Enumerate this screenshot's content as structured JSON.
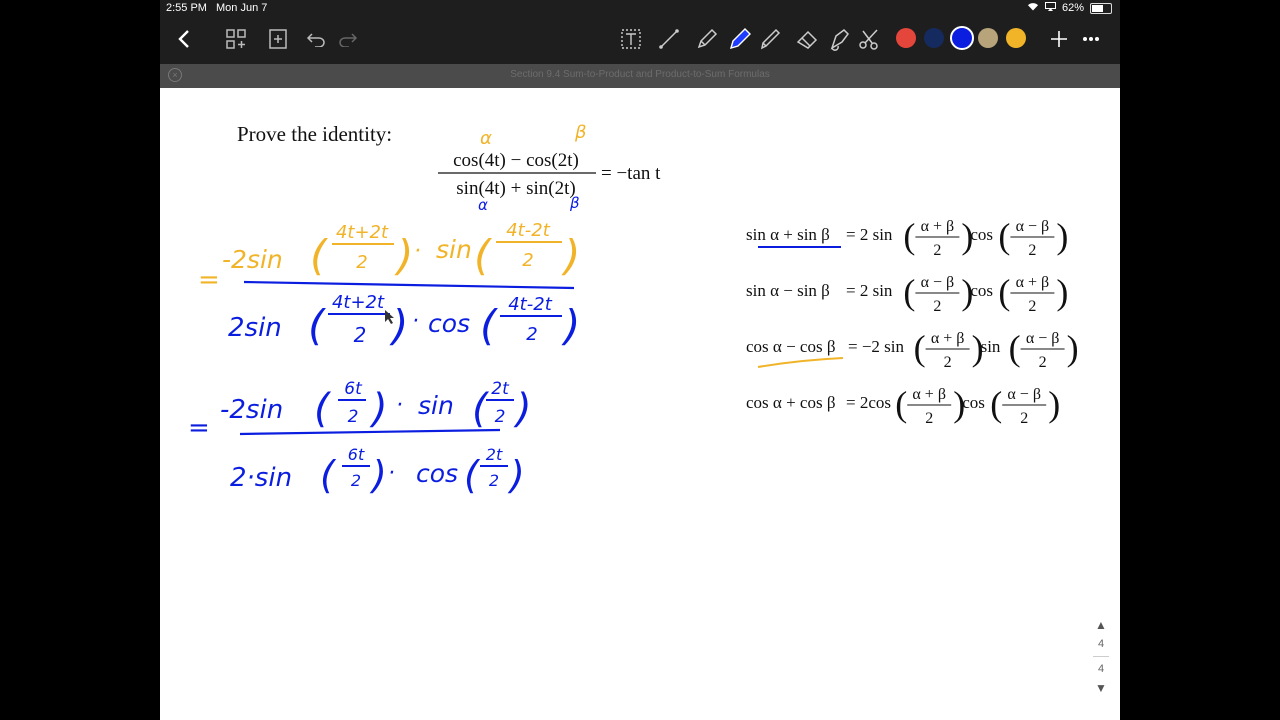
{
  "status": {
    "time": "2:55 PM",
    "date": "Mon Jun 7",
    "battery": "62%",
    "battery_level": 0.62
  },
  "document": {
    "title": "Section 9.4 Sum-to-Product and Product-to-Sum Formulas"
  },
  "toolbar": {
    "tools": [
      "back-icon",
      "thumbnails-icon",
      "add-page-icon",
      "undo-icon",
      "redo-icon",
      "text-tool-icon",
      "line-tool-icon",
      "pencil-icon",
      "pen-icon",
      "highlighter-icon",
      "eraser-icon",
      "lasso-icon",
      "scissors-icon",
      "add-icon",
      "more-icon"
    ],
    "colors": [
      "#e5463b",
      "#152a5e",
      "#0b1ee0",
      "#b8a47a",
      "#f1b429"
    ],
    "selected_color": "#0b1ee0"
  },
  "content": {
    "prove_label": "Prove the identity:",
    "identity": {
      "numerator": "cos(4t) − cos(2t)",
      "denominator": "sin(4t) + sin(2t)",
      "rhs": "= −tan t"
    },
    "formulas": [
      {
        "lhs": "sin α + sin β",
        "coef": "= 2 sin",
        "arg1": [
          "α + β",
          "2"
        ],
        "f2": "cos",
        "arg2": [
          "α − β",
          "2"
        ]
      },
      {
        "lhs": "sin α − sin β",
        "coef": "= 2 sin",
        "arg1": [
          "α − β",
          "2"
        ],
        "f2": "cos",
        "arg2": [
          "α + β",
          "2"
        ]
      },
      {
        "lhs": "cos α − cos β",
        "coef": "= −2 sin",
        "arg1": [
          "α + β",
          "2"
        ],
        "f2": "sin",
        "arg2": [
          "α − β",
          "2"
        ]
      },
      {
        "lhs": "cos α + cos β",
        "coef": "= 2cos",
        "arg1": [
          "α + β",
          "2"
        ],
        "f2": "cos",
        "arg2": [
          "α − β",
          "2"
        ]
      }
    ],
    "handwriting": {
      "alpha": "α",
      "beta": "β",
      "step1_eq": "=",
      "step1_num_coef": "-2sin",
      "step1_num_a": "4t+2t",
      "step1_num_b": "4t-2t",
      "step1_num_fn2": "sin",
      "step1_den_coef": "2sin",
      "step1_den_a": "4t+2t",
      "step1_den_b": "4t-2t",
      "step1_den_fn2": "cos",
      "step2_eq": "=",
      "step2_num_coef": "-2sin",
      "step2_num_a": "6t",
      "step2_num_fn2": "sin",
      "step2_num_b": "2t",
      "step2_den_coef": "2·sin",
      "step2_den_a": "6t",
      "step2_den_fn2": "cos",
      "step2_den_b": "2t",
      "two": "2",
      "dot": "·"
    }
  },
  "pager": {
    "current": "4",
    "total": "4"
  }
}
